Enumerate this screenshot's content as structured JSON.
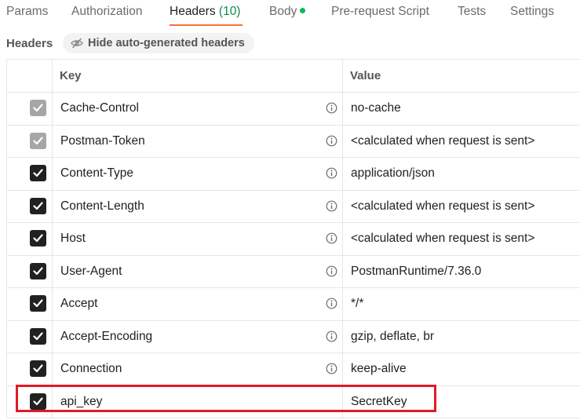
{
  "tabs": [
    {
      "label": "Params",
      "active": false
    },
    {
      "label": "Authorization",
      "active": false
    },
    {
      "label": "Headers",
      "count": "(10)",
      "active": true
    },
    {
      "label": "Body",
      "indicator": "green-dot",
      "active": false
    },
    {
      "label": "Pre-request Script",
      "active": false
    },
    {
      "label": "Tests",
      "active": false
    },
    {
      "label": "Settings",
      "active": false
    }
  ],
  "subheader": {
    "title": "Headers",
    "hide_button_label": "Hide auto-generated headers",
    "hide_button_icon": "eye-off-icon"
  },
  "table": {
    "columns": {
      "key": "Key",
      "value": "Value"
    },
    "rows": [
      {
        "key": "Cache-Control",
        "value": "no-cache",
        "checked": true,
        "auto_generated": true,
        "info_icon": "info-icon"
      },
      {
        "key": "Postman-Token",
        "value": "<calculated when request is sent>",
        "checked": true,
        "auto_generated": true,
        "info_icon": "info-icon"
      },
      {
        "key": "Content-Type",
        "value": "application/json",
        "checked": true,
        "auto_generated": false,
        "info_icon": "info-icon"
      },
      {
        "key": "Content-Length",
        "value": "<calculated when request is sent>",
        "checked": true,
        "auto_generated": false,
        "info_icon": "info-icon"
      },
      {
        "key": "Host",
        "value": "<calculated when request is sent>",
        "checked": true,
        "auto_generated": false,
        "info_icon": "info-icon"
      },
      {
        "key": "User-Agent",
        "value": "PostmanRuntime/7.36.0",
        "checked": true,
        "auto_generated": false,
        "info_icon": "info-icon"
      },
      {
        "key": "Accept",
        "value": "*/*",
        "checked": true,
        "auto_generated": false,
        "info_icon": "info-icon"
      },
      {
        "key": "Accept-Encoding",
        "value": "gzip, deflate, br",
        "checked": true,
        "auto_generated": false,
        "info_icon": "info-icon"
      },
      {
        "key": "Connection",
        "value": "keep-alive",
        "checked": true,
        "auto_generated": false,
        "info_icon": "info-icon"
      },
      {
        "key": "api_key",
        "value": "SecretKey",
        "checked": true,
        "auto_generated": false,
        "highlighted": true
      }
    ]
  },
  "colors": {
    "active_tab_underline": "#ff6c37",
    "count_green": "#0d8a4f",
    "body_dot": "#0cbb52",
    "highlight_border": "#e01b24",
    "checkbox_checked": "#212121",
    "checkbox_disabled": "#a6a6a6"
  }
}
